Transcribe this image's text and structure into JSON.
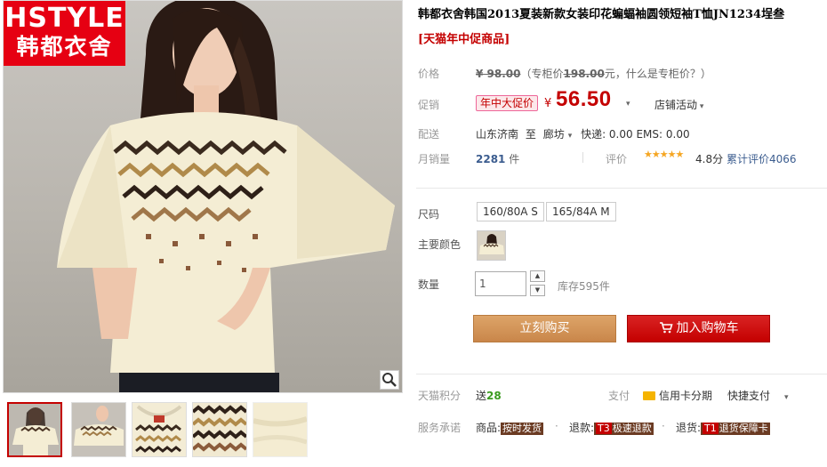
{
  "gallery": {
    "brand_line1": "HSTYLE",
    "brand_line2": "韩都衣舍",
    "zoom_icon": "magnifier-icon",
    "thumbnails": [
      "thumb-model-front",
      "thumb-model-side",
      "thumb-neckline",
      "thumb-pattern",
      "thumb-fabric"
    ]
  },
  "product": {
    "title": "韩都衣舍韩国2013夏装新款女装印花蝙蝠袖圆领短袖T恤JN1234埕叁",
    "subtitle": "[天猫年中促商品]"
  },
  "price": {
    "label": "价格",
    "original": "¥ 98.00",
    "note_prefix": "（专柜价",
    "counter_price": "198.00",
    "note_suffix": "元，什么是专柜价？）"
  },
  "promo": {
    "label": "促销",
    "tag": "年中大促价",
    "currency": "¥",
    "price": "56.50",
    "store_activity": "店铺活动"
  },
  "shipping": {
    "label": "配送",
    "from": "山东济南",
    "to_word": "至",
    "to": "廊坊",
    "fees": "快递: 0.00 EMS: 0.00"
  },
  "sales": {
    "label": "月销量",
    "count": "2281",
    "unit": "件",
    "rating_label": "评价",
    "stars": "★★★★★",
    "score": "4.8分",
    "cumulative": "累计评价4066"
  },
  "options": {
    "size_label": "尺码",
    "sizes": [
      "160/80A S",
      "165/84A M"
    ],
    "color_label": "主要颜色",
    "qty_label": "数量",
    "qty_value": "1",
    "stock": "库存595件"
  },
  "actions": {
    "buy_now": "立刻购买",
    "add_cart": "加入购物车"
  },
  "points": {
    "label": "天猫积分",
    "send": "送",
    "amount": "28",
    "pay_label": "支付",
    "credit": "信用卡分期",
    "quick": "快捷支付"
  },
  "service": {
    "label": "服务承诺",
    "goods_prefix": "商品:",
    "goods_tag": "按时发货",
    "refund_prefix": "退款:",
    "refund_num": "T3",
    "refund_tag": "极速退款",
    "return_prefix": "退货:",
    "return_num": "T1",
    "return_tag": "退货保障卡"
  }
}
